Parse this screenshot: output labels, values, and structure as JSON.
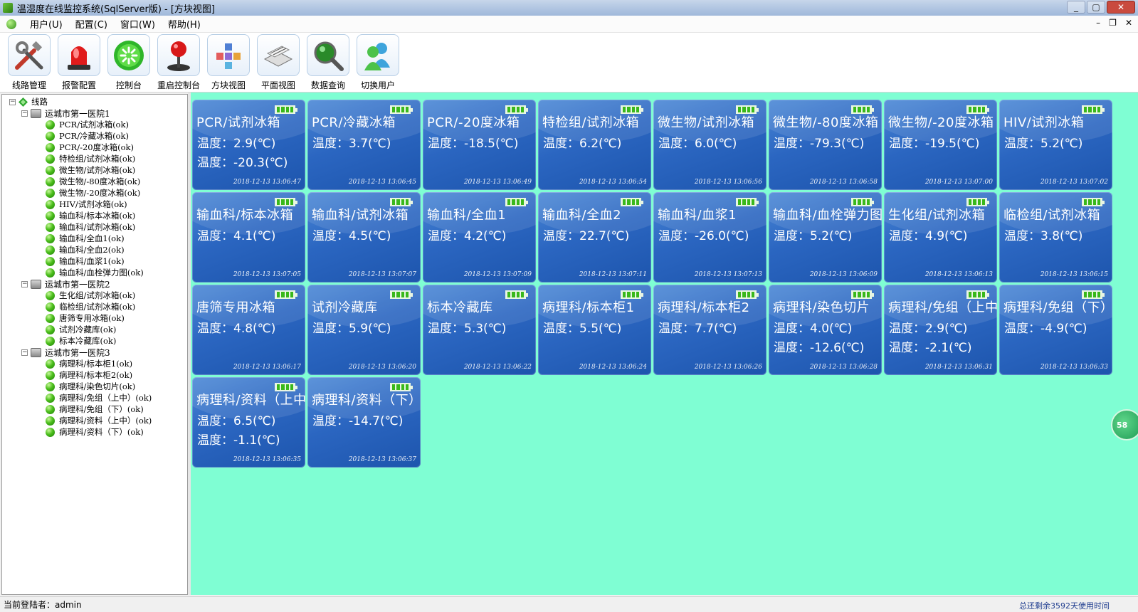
{
  "window": {
    "title": "温湿度在线监控系统(SqlServer版) - [方块视图]",
    "minimize": "_",
    "maximize": "▢",
    "close": "✕"
  },
  "menu": {
    "items": [
      "用户(U)",
      "配置(C)",
      "窗口(W)",
      "帮助(H)"
    ],
    "mdi_min": "–",
    "mdi_restore": "❐",
    "mdi_close": "✕"
  },
  "toolbar": {
    "items": [
      {
        "label": "线路管理",
        "icon": "tools-icon"
      },
      {
        "label": "报警配置",
        "icon": "alarm-siren-icon"
      },
      {
        "label": "控制台",
        "icon": "console-icon"
      },
      {
        "label": "重启控制台",
        "icon": "joystick-icon"
      },
      {
        "label": "方块视图",
        "icon": "block-view-icon"
      },
      {
        "label": "平面视图",
        "icon": "plan-view-icon"
      },
      {
        "label": "数据查询",
        "icon": "magnifier-icon"
      },
      {
        "label": "切换用户",
        "icon": "users-icon"
      }
    ]
  },
  "tree": {
    "root": "线路",
    "hospitals": [
      {
        "name": "运城市第一医院1",
        "nodes": [
          "PCR/试剂冰箱(ok)",
          "PCR/冷藏冰箱(ok)",
          "PCR/-20度冰箱(ok)",
          "特检组/试剂冰箱(ok)",
          "微生物/试剂冰箱(ok)",
          "微生物/-80度冰箱(ok)",
          "微生物/-20度冰箱(ok)",
          "HIV/试剂冰箱(ok)",
          "输血科/标本冰箱(ok)",
          "输血科/试剂冰箱(ok)",
          "输血科/全血1(ok)",
          "输血科/全血2(ok)",
          "输血科/血浆1(ok)",
          "输血科/血栓弹力图(ok)"
        ]
      },
      {
        "name": "运城市第一医院2",
        "nodes": [
          "生化组/试剂冰箱(ok)",
          "临检组/试剂冰箱(ok)",
          "唐筛专用冰箱(ok)",
          "试剂冷藏库(ok)",
          "标本冷藏库(ok)"
        ]
      },
      {
        "name": "运城市第一医院3",
        "nodes": [
          "病理科/标本柜1(ok)",
          "病理科/标本柜2(ok)",
          "病理科/染色切片(ok)",
          "病理科/免组（上中）(ok)",
          "病理科/免组（下）(ok)",
          "病理科/资料（上中）(ok)",
          "病理科/资料（下）(ok)"
        ]
      }
    ]
  },
  "cards": [
    {
      "name": "PCR/试剂冰箱",
      "readings": [
        "温度：2.9(℃)",
        "温度：-20.3(℃)"
      ],
      "time": "2018-12-13 13:06:47"
    },
    {
      "name": "PCR/冷藏冰箱",
      "readings": [
        "温度：3.7(℃)"
      ],
      "time": "2018-12-13 13:06:45"
    },
    {
      "name": "PCR/-20度冰箱",
      "readings": [
        "温度：-18.5(℃)"
      ],
      "time": "2018-12-13 13:06:49"
    },
    {
      "name": "特检组/试剂冰箱",
      "readings": [
        "温度：6.2(℃)"
      ],
      "time": "2018-12-13 13:06:54"
    },
    {
      "name": "微生物/试剂冰箱",
      "readings": [
        "温度：6.0(℃)"
      ],
      "time": "2018-12-13 13:06:56"
    },
    {
      "name": "微生物/-80度冰箱",
      "readings": [
        "温度：-79.3(℃)"
      ],
      "time": "2018-12-13 13:06:58"
    },
    {
      "name": "微生物/-20度冰箱",
      "readings": [
        "温度：-19.5(℃)"
      ],
      "time": "2018-12-13 13:07:00"
    },
    {
      "name": "HIV/试剂冰箱",
      "readings": [
        "温度：5.2(℃)"
      ],
      "time": "2018-12-13 13:07:02"
    },
    {
      "name": "输血科/标本冰箱",
      "readings": [
        "温度：4.1(℃)"
      ],
      "time": "2018-12-13 13:07:05"
    },
    {
      "name": "输血科/试剂冰箱",
      "readings": [
        "温度：4.5(℃)"
      ],
      "time": "2018-12-13 13:07:07"
    },
    {
      "name": "输血科/全血1",
      "readings": [
        "温度：4.2(℃)"
      ],
      "time": "2018-12-13 13:07:09"
    },
    {
      "name": "输血科/全血2",
      "readings": [
        "温度：22.7(℃)"
      ],
      "time": "2018-12-13 13:07:11"
    },
    {
      "name": "输血科/血浆1",
      "readings": [
        "温度：-26.0(℃)"
      ],
      "time": "2018-12-13 13:07:13"
    },
    {
      "name": "输血科/血栓弹力图",
      "readings": [
        "温度：5.2(℃)"
      ],
      "time": "2018-12-13 13:06:09"
    },
    {
      "name": "生化组/试剂冰箱",
      "readings": [
        "温度：4.9(℃)"
      ],
      "time": "2018-12-13 13:06:13"
    },
    {
      "name": "临检组/试剂冰箱",
      "readings": [
        "温度：3.8(℃)"
      ],
      "time": "2018-12-13 13:06:15"
    },
    {
      "name": "唐筛专用冰箱",
      "readings": [
        "温度：4.8(℃)"
      ],
      "time": "2018-12-13 13:06:17"
    },
    {
      "name": "试剂冷藏库",
      "readings": [
        "温度：5.9(℃)"
      ],
      "time": "2018-12-13 13:06:20"
    },
    {
      "name": "标本冷藏库",
      "readings": [
        "温度：5.3(℃)"
      ],
      "time": "2018-12-13 13:06:22"
    },
    {
      "name": "病理科/标本柜1",
      "readings": [
        "温度：5.5(℃)"
      ],
      "time": "2018-12-13 13:06:24"
    },
    {
      "name": "病理科/标本柜2",
      "readings": [
        "温度：7.7(℃)"
      ],
      "time": "2018-12-13 13:06:26"
    },
    {
      "name": "病理科/染色切片",
      "readings": [
        "温度：4.0(℃)",
        "温度：-12.6(℃)"
      ],
      "time": "2018-12-13 13:06:28"
    },
    {
      "name": "病理科/免组（上中",
      "readings": [
        "温度：2.9(℃)",
        "温度：-2.1(℃)"
      ],
      "time": "2018-12-13 13:06:31"
    },
    {
      "name": "病理科/免组（下）",
      "readings": [
        "温度：-4.9(℃)"
      ],
      "time": "2018-12-13 13:06:33"
    },
    {
      "name": "病理科/资料（上中",
      "readings": [
        "温度：6.5(℃)",
        "温度：-1.1(℃)"
      ],
      "time": "2018-12-13 13:06:35"
    },
    {
      "name": "病理科/资料（下）",
      "readings": [
        "温度：-14.7(℃)"
      ],
      "time": "2018-12-13 13:06:37"
    }
  ],
  "float_badge": "58",
  "status": {
    "login": "当前登陆者：admin",
    "days": "总还剩余3592天使用时间"
  },
  "colors": {
    "card_blue": "#2b66c1",
    "main_bg": "#7ffed3",
    "ok_green": "#39b81b"
  }
}
